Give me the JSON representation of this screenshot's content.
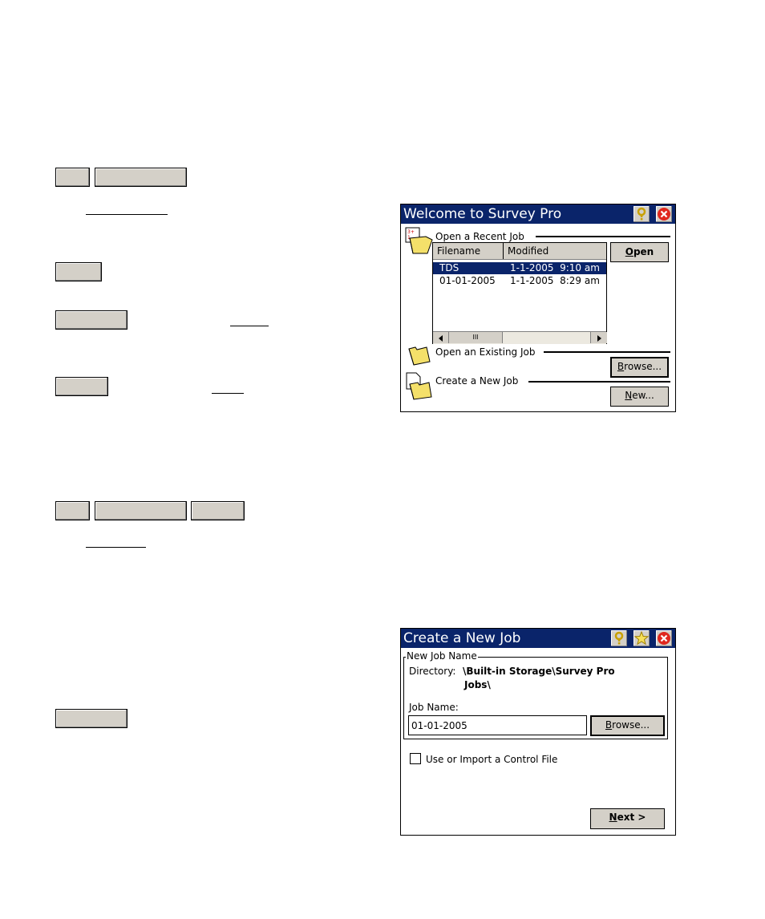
{
  "welcome": {
    "title": "Welcome to Survey Pro",
    "recent_section": "Open a Recent Job",
    "columns": [
      "Filename",
      "Modified"
    ],
    "rows": [
      {
        "filename": "TDS",
        "modified": "1-1-2005  9:10 am"
      },
      {
        "filename": "01-01-2005",
        "modified": "1-1-2005  8:29 am"
      }
    ],
    "open_key": "O",
    "open_rest": "pen",
    "existing_section": "Open an Existing Job",
    "browse_key": "B",
    "browse_rest": "rowse...",
    "new_section": "Create a New Job",
    "new_key": "N",
    "new_rest": "ew...",
    "scroll_thumb_glyph": "III"
  },
  "create": {
    "title": "Create a New Job",
    "group_label": "New Job Name",
    "directory_label": "Directory:",
    "directory_line1": "\\Built-in Storage\\Survey Pro",
    "directory_line2": "Jobs\\",
    "job_name_label": "Job Name:",
    "job_name_value": "01-01-2005",
    "browse_key": "B",
    "browse_rest": "rowse...",
    "checkbox_label": "Use or Import a Control File",
    "next_key": "N",
    "next_rest": "ext >"
  },
  "colors": {
    "titlebar": "#0a246a",
    "button_face": "#d4d0c8",
    "selection": "#0a246a",
    "close_red": "#e0281e"
  }
}
